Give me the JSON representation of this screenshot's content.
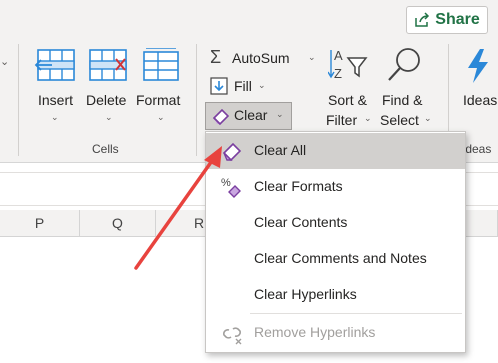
{
  "share": {
    "label": "Share",
    "icon": "share-icon"
  },
  "cells_group": {
    "label": "Cells",
    "buttons": [
      {
        "label": "Insert",
        "icon": "insert-cells-icon"
      },
      {
        "label": "Delete",
        "icon": "delete-cells-icon"
      },
      {
        "label": "Format",
        "icon": "format-cells-icon"
      }
    ]
  },
  "editing": {
    "autosum": "AutoSum",
    "fill": "Fill",
    "clear": "Clear",
    "sort_filter": [
      "Sort &",
      "Filter"
    ],
    "find_select": [
      "Find &",
      "Select"
    ]
  },
  "ideas": {
    "label": "Ideas",
    "group_label": "Ideas"
  },
  "columns": [
    "P",
    "Q",
    "R"
  ],
  "clear_menu": {
    "items": [
      {
        "label": "Clear All",
        "icon": "eraser-icon",
        "selected": true,
        "enabled": true
      },
      {
        "label": "Clear Formats",
        "icon": "clear-formats-icon",
        "selected": false,
        "enabled": true
      },
      {
        "label": "Clear Contents",
        "icon": "",
        "selected": false,
        "enabled": true
      },
      {
        "label": "Clear Comments and Notes",
        "icon": "",
        "selected": false,
        "enabled": true
      },
      {
        "label": "Clear Hyperlinks",
        "icon": "",
        "selected": false,
        "enabled": true
      },
      {
        "label": "Remove Hyperlinks",
        "icon": "remove-hyperlinks-icon",
        "selected": false,
        "enabled": false
      }
    ]
  },
  "colors": {
    "accent_green": "#217346",
    "eraser_purple": "#7b3fa0",
    "arrow_red": "#e8433e",
    "icon_blue": "#2b88d8"
  }
}
